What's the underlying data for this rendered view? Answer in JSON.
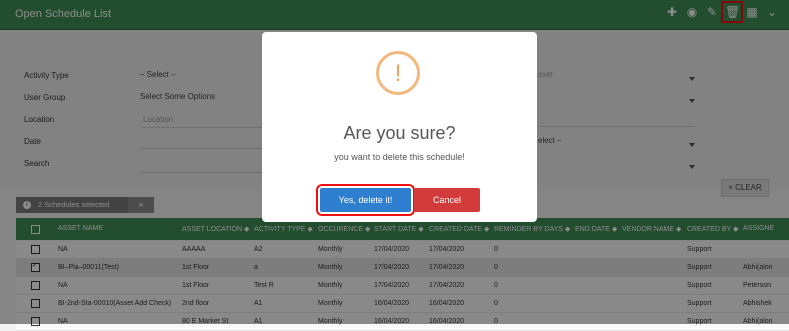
{
  "window": {
    "title": "Open Schedule List"
  },
  "toolbar": {
    "icons": [
      "plus-icon",
      "eye-icon",
      "pencil-icon",
      "trash-icon",
      "grid-icon",
      "chevron-down-icon"
    ]
  },
  "filters": {
    "activity_type": {
      "label": "Activity Type",
      "value": "– Select –"
    },
    "user_group": {
      "label": "User Group",
      "value": "Select Some Options"
    },
    "location": {
      "label": "Location",
      "placeholder": "Location"
    },
    "date": {
      "label": "Date"
    },
    "search": {
      "label": "Search"
    },
    "asset": {
      "value": "sset"
    },
    "right_select": {
      "value": "elect –"
    }
  },
  "clear_label": "× CLEAR",
  "selection": {
    "info": "i",
    "text": "2 Schedules selected",
    "close": "×"
  },
  "table": {
    "headers": [
      "ASSET NAME",
      "ASSET LOCATION ◆",
      "ACTIVITY TYPE ◆",
      "OCCURENCE ◆",
      "START DATE ◆",
      "CREATED DATE ◆",
      "REMINDER BY DAYS ◆",
      "END DATE ◆",
      "VENDOR NAME ◆",
      "CREATED BY ◆",
      "ASSIGNE"
    ],
    "rows": [
      {
        "checked": false,
        "cells": [
          "NA",
          "AAAAA",
          "A2",
          "Monthly",
          "17/04/2020",
          "17/04/2020",
          "0",
          "",
          "",
          "Support",
          ""
        ]
      },
      {
        "checked": true,
        "cells": [
          "BI–Pla–00011(Test)",
          "1st Floor",
          "a",
          "Monthly",
          "17/04/2020",
          "17/04/2020",
          "0",
          "",
          "",
          "Support",
          "Abhi(alon"
        ]
      },
      {
        "checked": false,
        "cells": [
          "NA",
          "1st Floor",
          "Test R",
          "Monthly",
          "17/04/2020",
          "17/04/2020",
          "0",
          "",
          "",
          "Support",
          "Peterson"
        ]
      },
      {
        "checked": false,
        "cells": [
          "BI-2nd-Sta-00010(Asset Add Check)",
          "2nd floor",
          "A1",
          "Monthly",
          "16/04/2020",
          "16/04/2020",
          "0",
          "",
          "",
          "Support",
          "Abhishek"
        ]
      },
      {
        "checked": false,
        "cells": [
          "NA",
          "80 E Market St",
          "A1",
          "Monthly",
          "16/04/2020",
          "16/04/2020",
          "0",
          "",
          "",
          "Support",
          "Abhi(alon"
        ]
      }
    ]
  },
  "dialog": {
    "icon": "!",
    "title": "Are you sure?",
    "message": "you want to delete this schedule!",
    "confirm_label": "Yes, delete it!",
    "cancel_label": "Cancel"
  },
  "colors": {
    "header_green": "#3f8c55",
    "confirm_blue": "#2f7fd0",
    "cancel_red": "#d33a3a",
    "warning_orange": "#f0a15b"
  }
}
